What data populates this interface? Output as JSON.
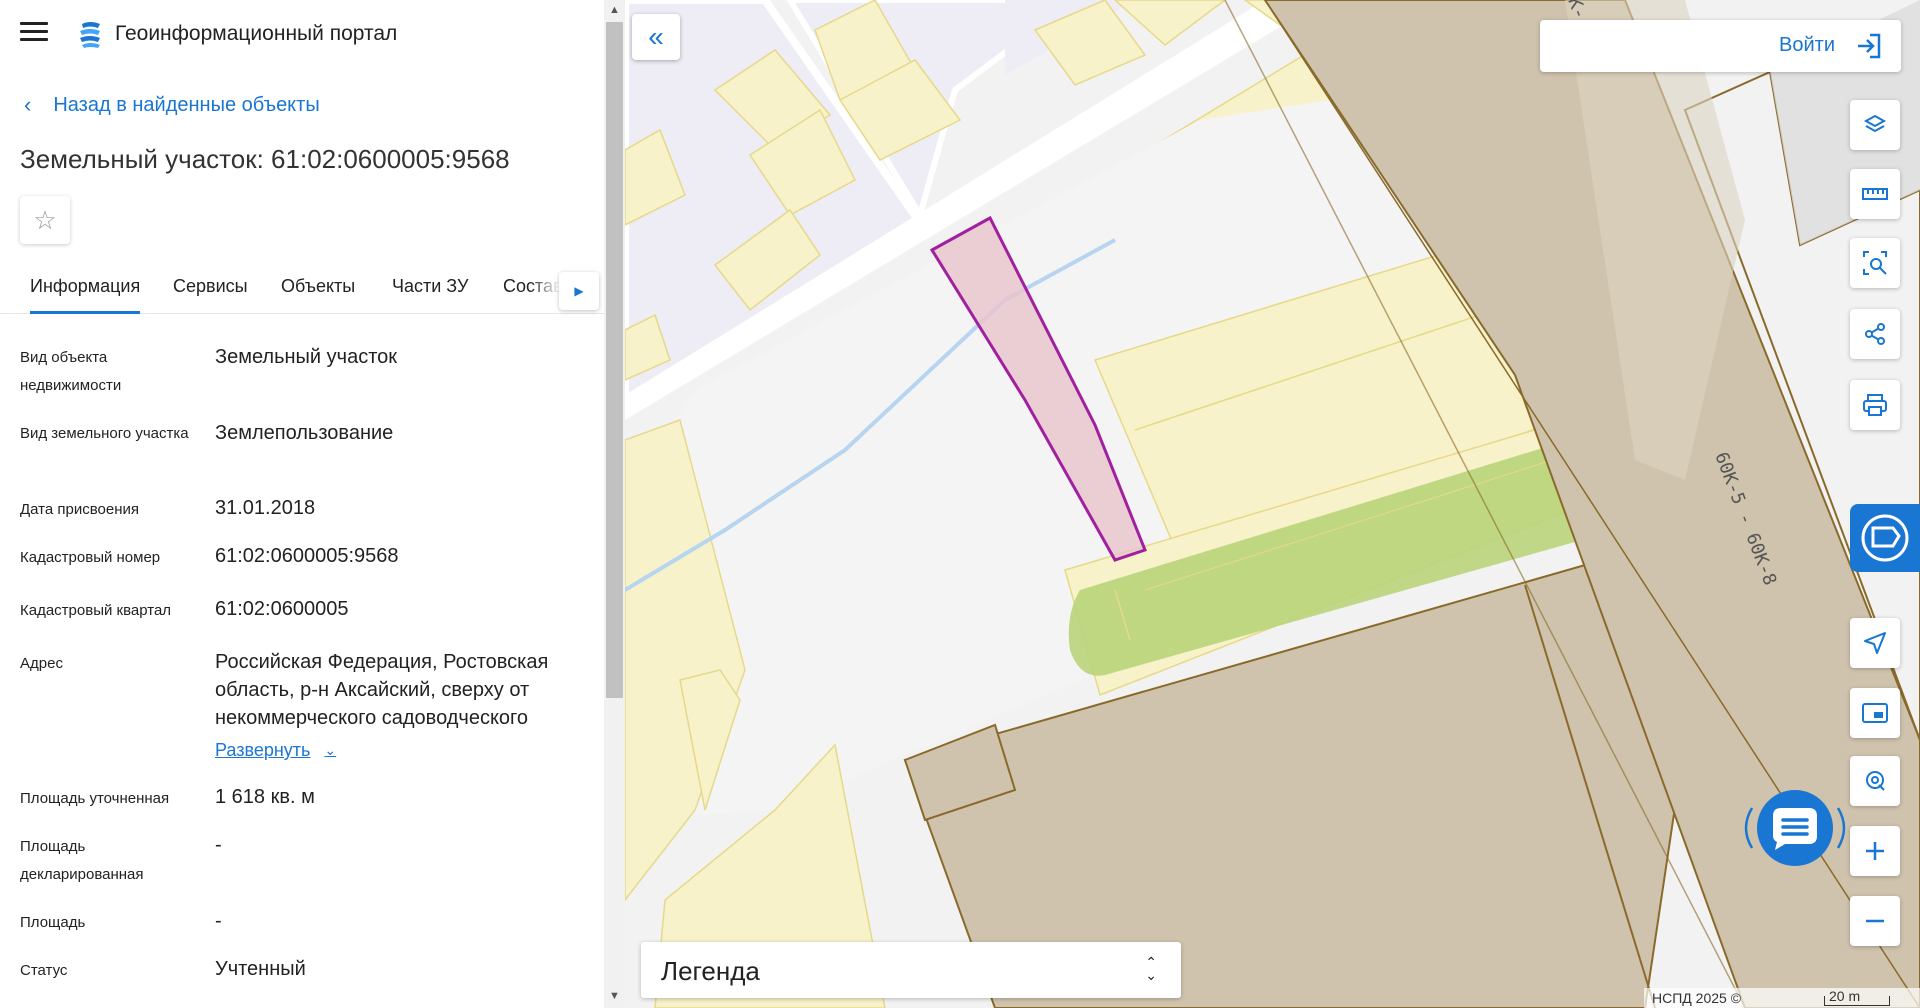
{
  "header": {
    "portal_title": "Геоинформационный портал"
  },
  "navigation": {
    "back_label": "Назад в найденные объекты"
  },
  "object": {
    "title": "Земельный участок: 61:02:0600005:9568"
  },
  "tabs": [
    {
      "label": "Информация",
      "active": true
    },
    {
      "label": "Сервисы",
      "active": false
    },
    {
      "label": "Объекты",
      "active": false
    },
    {
      "label": "Части ЗУ",
      "active": false
    },
    {
      "label": "Состав",
      "active": false
    }
  ],
  "properties": [
    {
      "label": "Вид объекта недвижимости",
      "value": "Земельный участок"
    },
    {
      "label": "Вид земельного участка",
      "value": "Землепользование"
    },
    {
      "label": "Дата присвоения",
      "value": "31.01.2018"
    },
    {
      "label": "Кадастровый номер",
      "value": "61:02:0600005:9568"
    },
    {
      "label": "Кадастровый квартал",
      "value": "61:02:0600005"
    },
    {
      "label": "Адрес",
      "value": "Российская Федерация, Ростовская область, р-н Аксайский, сверху от некоммерческого садоводческого"
    },
    {
      "label": "Площадь уточненная",
      "value": "1 618 кв. м"
    },
    {
      "label": "Площадь декларированная",
      "value": "-"
    },
    {
      "label": "Площадь",
      "value": "-"
    },
    {
      "label": "Статус",
      "value": "Учтенный"
    }
  ],
  "expand_label": "Развернуть",
  "map": {
    "login_label": "Войти",
    "legend_label": "Легенда",
    "attribution": "НСПД 2025 ©",
    "scale_label": "20 m",
    "road_label": "60К-5 - 60К-8",
    "road_label_top": "К-",
    "toolbar_icons": [
      "layers-icon",
      "ruler-icon",
      "area-select-icon",
      "share-icon",
      "print-icon"
    ],
    "nav_icons": [
      "navigate-icon",
      "minimap-icon",
      "locate-icon",
      "zoom-in-icon",
      "zoom-out-icon"
    ]
  },
  "colors": {
    "accent": "#1976d2",
    "parcel_yellow": "#f7f2c9",
    "parcel_outline": "#e6d98a",
    "selected_fill": "#e8c4cc",
    "selected_outline": "#a020a0",
    "green_zone": "#b9d47a",
    "brown_area": "#cfc3ad",
    "brown_outline": "#8a6a2a",
    "water_line": "#b7d4f0"
  }
}
